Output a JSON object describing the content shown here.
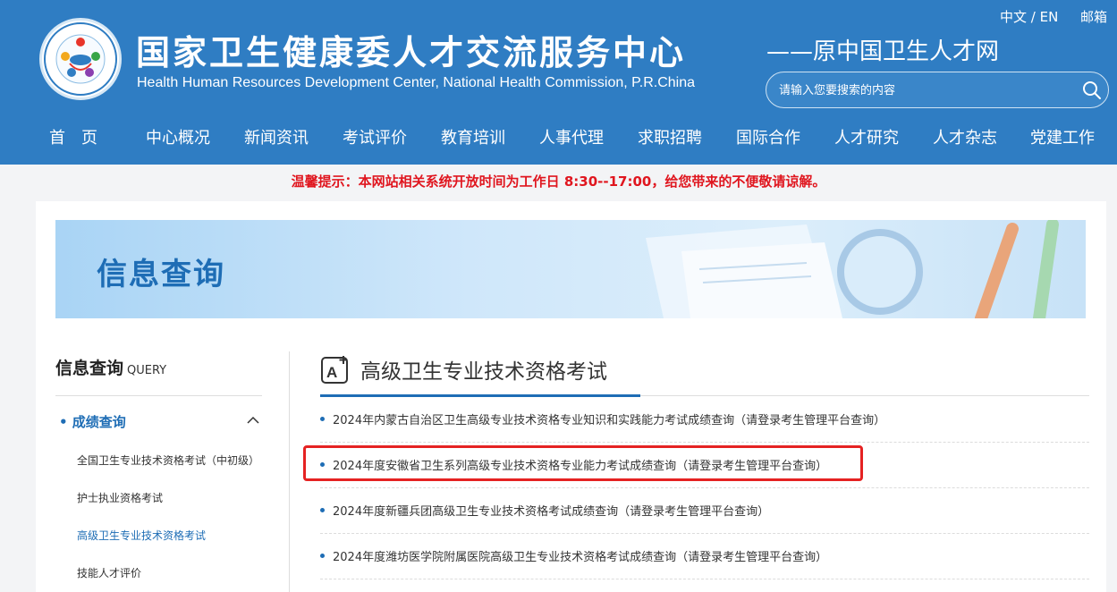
{
  "header": {
    "title": "国家卫生健康委人才交流服务中心",
    "subtitle": "Health Human Resources Development Center, National Health Commission, P.R.China",
    "slogan": "——原中国卫生人才网",
    "lang": "中文 / EN",
    "mail": "邮箱",
    "search_placeholder": "请输入您要搜索的内容"
  },
  "nav": [
    "首　页",
    "中心概况",
    "新闻资讯",
    "考试评价",
    "教育培训",
    "人事代理",
    "求职招聘",
    "国际合作",
    "人才研究",
    "人才杂志",
    "党建工作"
  ],
  "notice": "温馨提示：本网站相关系统开放时间为工作日 8:30--17:00，给您带来的不便敬请谅解。",
  "banner": {
    "title": "信息查询"
  },
  "sidebar": {
    "title": "信息查询",
    "title_en": "QUERY",
    "category": "• 成绩查询",
    "items": [
      "全国卫生专业技术资格考试（中初级）",
      "护士执业资格考试",
      "高级卫生专业技术资格考试",
      "技能人才评价"
    ]
  },
  "main": {
    "title": "高级卫生专业技术资格考试",
    "rows": [
      "2024年内蒙古自治区卫生高级专业技术资格专业知识和实践能力考试成绩查询（请登录考生管理平台查询）",
      "2024年度安徽省卫生系列高级专业技术资格专业能力考试成绩查询（请登录考生管理平台查询）",
      "2024年度新疆兵团高级卫生专业技术资格考试成绩查询（请登录考生管理平台查询）",
      "2024年度潍坊医学院附属医院高级卫生专业技术资格考试成绩查询（请登录考生管理平台查询）"
    ]
  },
  "colors": {
    "brand": "#2f7dc3",
    "accent": "#1e6db5",
    "notice": "#e0161f",
    "highlight": "#e52222"
  }
}
